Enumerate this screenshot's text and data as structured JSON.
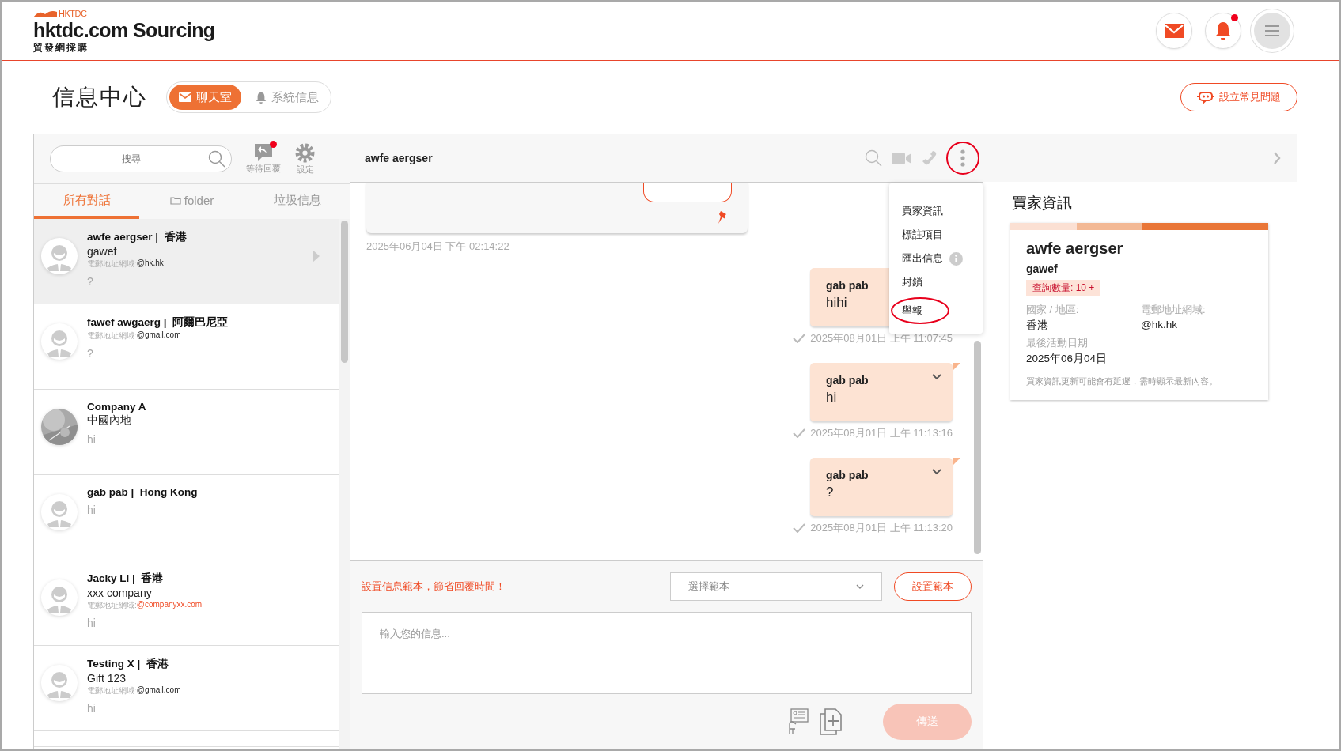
{
  "logo": {
    "brand": "HKTDC",
    "title": "hktdc.com Sourcing",
    "subtitle": "貿發網採購"
  },
  "header_buttons": [
    {
      "kind": "mail",
      "badge": false
    },
    {
      "kind": "bell",
      "badge": true
    },
    {
      "kind": "menu",
      "badge": false
    }
  ],
  "page_title": "信息中心",
  "mode_tabs": [
    {
      "label": "聊天室",
      "kind": "mail",
      "selected": true
    },
    {
      "label": "系統信息",
      "kind": "bell",
      "selected": false
    }
  ],
  "faq_button": "設立常見問題",
  "sidebar": {
    "search": {
      "placeholder": "搜尋"
    },
    "tools": [
      {
        "kind": "reply",
        "label": "等待回覆",
        "badge": true
      },
      {
        "kind": "settings",
        "label": "設定",
        "badge": false
      }
    ],
    "tabs": [
      {
        "label": "所有對話",
        "kind": "plain",
        "selected": true
      },
      {
        "label": "folder",
        "kind": "folder",
        "selected": false
      },
      {
        "label": "垃圾信息",
        "kind": "plain",
        "selected": false
      }
    ],
    "conversations": [
      {
        "title": "awfe aergser |  香港",
        "company": "gawef",
        "email_label": "電郵地址網域:",
        "email_domain": "@hk.hk",
        "domain_flagged": false,
        "preview": "?",
        "kind": "person",
        "selected": true
      },
      {
        "title": "fawef awgaerg |  阿爾巴尼亞",
        "email_label": "電郵地址網域:",
        "email_domain": "@gmail.com",
        "domain_flagged": false,
        "preview": "?",
        "kind": "person",
        "selected": false
      },
      {
        "title": "Company A",
        "company": "中國內地",
        "preview": "hi",
        "selected": false
      },
      {
        "title": "gab pab |  Hong Kong",
        "preview": "hi",
        "kind": "person",
        "selected": false
      },
      {
        "title": "Jacky Li |  香港",
        "company": "xxx company",
        "email_label": "電郵地址網域:",
        "email_domain": "@companyxx.com",
        "domain_flagged": true,
        "preview": "hi",
        "kind": "person",
        "selected": false
      },
      {
        "title": "Testing X |  香港",
        "company": "Gift 123",
        "email_label": "電郵地址網域:",
        "email_domain": "@gmail.com",
        "domain_flagged": false,
        "preview": "hi",
        "kind": "person",
        "selected": false
      }
    ]
  },
  "chat": {
    "title": "awfe aergser",
    "more_highlighted": true,
    "menu": {
      "items": [
        {
          "label": "買家資訊",
          "info": false,
          "highlighted": false
        },
        {
          "label": "標註項目",
          "info": false,
          "highlighted": false
        },
        {
          "label": "匯出信息",
          "info": true,
          "highlighted": false
        },
        {
          "label": "封鎖",
          "info": false,
          "highlighted": false
        },
        {
          "label": "舉報",
          "info": false,
          "highlighted": true
        }
      ]
    },
    "messages": [
      {
        "kind": "card",
        "pinned": true,
        "time": "2025年06月04日 下午 02:14:22"
      },
      {
        "kind": "outgoing",
        "sender": "gab pab",
        "text": "hihi",
        "time": "2025年08月01日 上午 11:07:45",
        "read": true
      },
      {
        "kind": "outgoing",
        "sender": "gab pab",
        "text": "hi",
        "time": "2025年08月01日 上午 11:13:16",
        "read": true
      },
      {
        "kind": "outgoing",
        "sender": "gab pab",
        "text": "?",
        "time": "2025年08月01日 上午 11:13:20",
        "read": true
      }
    ],
    "composer": {
      "hint": "設置信息範本，節省回覆時間！",
      "template_select": {
        "placeholder": "選擇範本"
      },
      "template_button": "設置範本",
      "message": {
        "placeholder": "輸入您的信息..."
      },
      "send_button": "傳送",
      "send_disabled": true
    }
  },
  "buyer_info": {
    "title": "買家資訊",
    "name": "awfe aergser",
    "company": "gawef",
    "badge": "查詢數量: 10 +",
    "fields": [
      {
        "label": "國家 / 地區:",
        "value": "香港"
      },
      {
        "label": "電郵地址網域:",
        "value": "@hk.hk"
      },
      {
        "label": "最後活動日期",
        "value": "2025年06月04日"
      }
    ],
    "note": "買家資訊更新可能會有延遲，需時顯示最新內容。"
  }
}
